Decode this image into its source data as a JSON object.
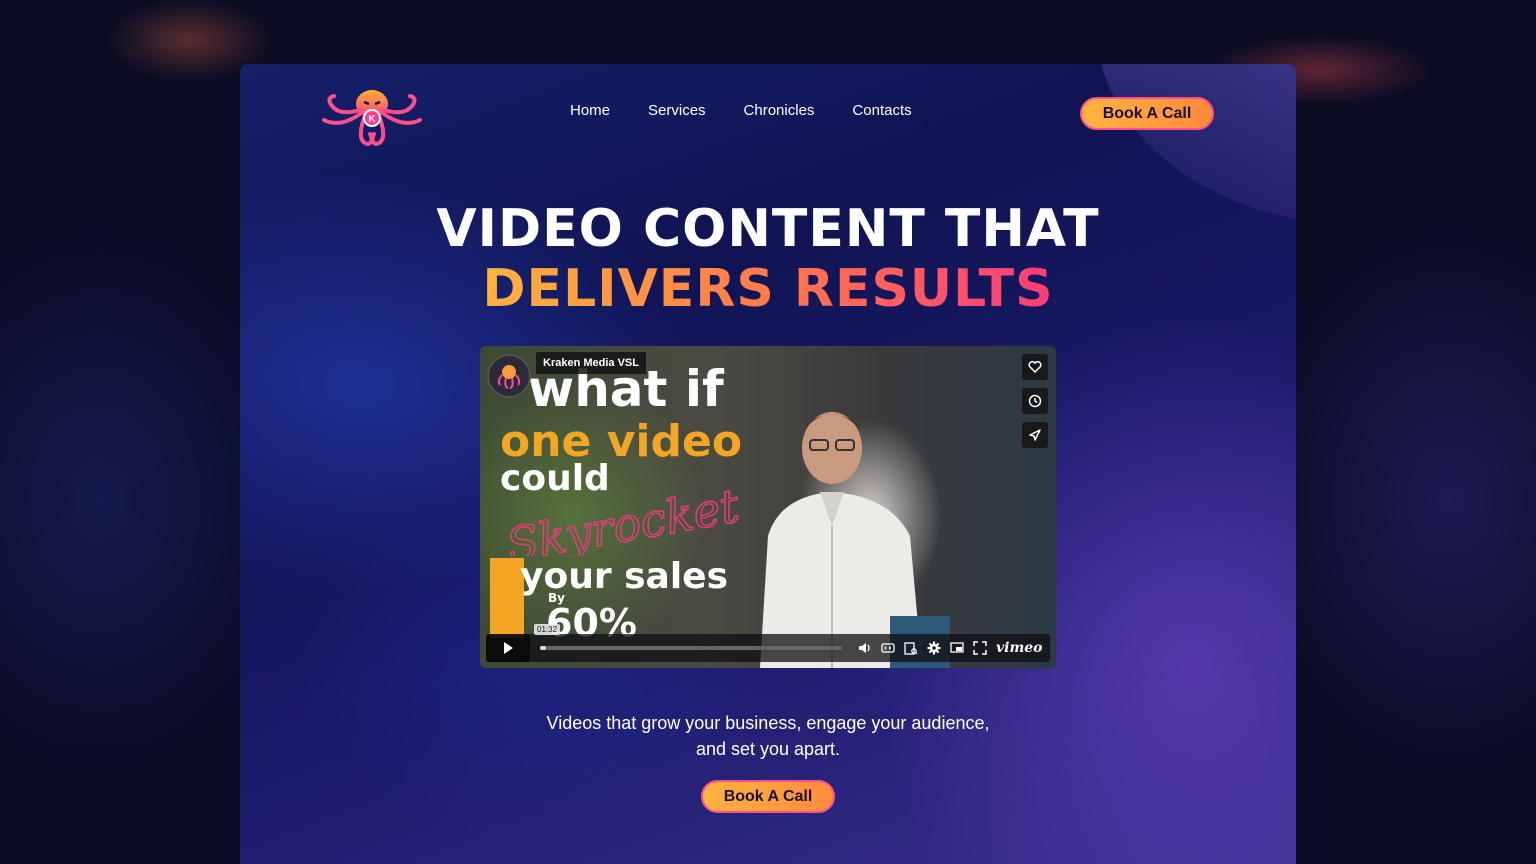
{
  "nav": {
    "items": [
      "Home",
      "Services",
      "Chronicles",
      "Contacts"
    ],
    "cta_label": "Book A Call"
  },
  "logo": {
    "icon": "octopus-k-logo",
    "letter": "K"
  },
  "hero": {
    "line1": "VIDEO CONTENT THAT",
    "line2": "DELIVERS RESULTS",
    "subtitle": "Videos that grow your business, engage your audience, and set you apart.",
    "cta_label": "Book A Call"
  },
  "video": {
    "title": "Kraken Media VSL",
    "overlay": {
      "line1": "what if",
      "line2": "one video",
      "line3": "could",
      "script_word": "Skyrocket",
      "line4": "your sales",
      "line5": "By",
      "line6": "60%"
    },
    "time_tooltip": "01:32",
    "progress": 0.02,
    "brand": "vimeo",
    "side_icons": [
      "heart-icon",
      "clock-icon",
      "send-icon"
    ]
  },
  "colors": {
    "accent_orange": "#ffb340",
    "accent_pink": "#ff4f8a",
    "text": "#ffffff"
  }
}
